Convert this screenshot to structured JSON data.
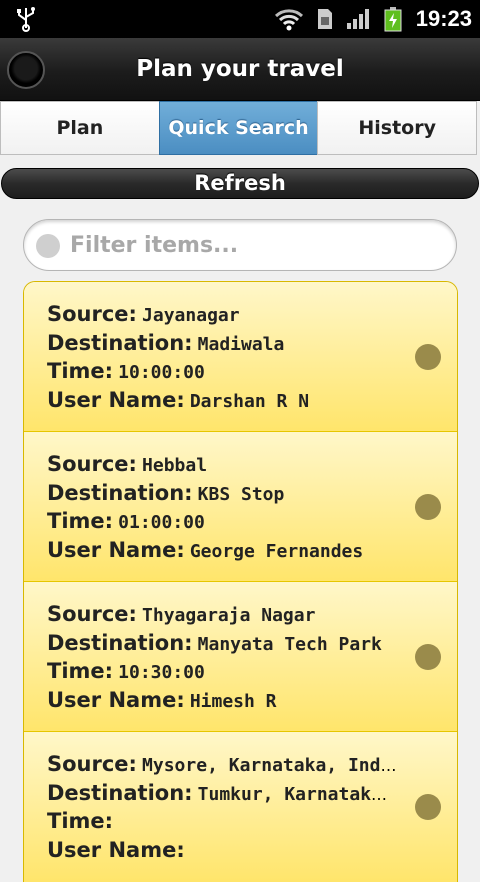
{
  "status_bar": {
    "time": "19:23",
    "icons": [
      "usb-icon",
      "wifi-icon",
      "sim-icon",
      "signal-icon",
      "battery-charging-icon"
    ]
  },
  "header": {
    "title": "Plan your travel",
    "home_icon": "home-circle-icon"
  },
  "tabs": [
    {
      "label": "Plan",
      "active": false
    },
    {
      "label": "Quick Search",
      "active": true
    },
    {
      "label": "History",
      "active": false
    }
  ],
  "refresh_label": "Refresh",
  "search": {
    "placeholder": "Filter items...",
    "value": ""
  },
  "labels": {
    "source": "Source:",
    "destination": "Destination:",
    "time": "Time:",
    "user_name": "User Name:"
  },
  "items": [
    {
      "source": "Jayanagar",
      "destination": "Madiwala",
      "time": "10:00:00",
      "user_name": "Darshan R N"
    },
    {
      "source": "Hebbal",
      "destination": "KBS Stop",
      "time": "01:00:00",
      "user_name": "George Fernandes"
    },
    {
      "source": "Thyagaraja Nagar",
      "destination": "Manyata Tech Park",
      "time": "10:30:00",
      "user_name": "Himesh R"
    },
    {
      "source": "Mysore, Karnataka, India",
      "destination": "Tumkur, Karnataka...",
      "time": "",
      "user_name": ""
    }
  ],
  "colors": {
    "active_tab": "#4b8ec2",
    "item_bg": "#ffe56b",
    "indicator": "#9a8b4b"
  }
}
